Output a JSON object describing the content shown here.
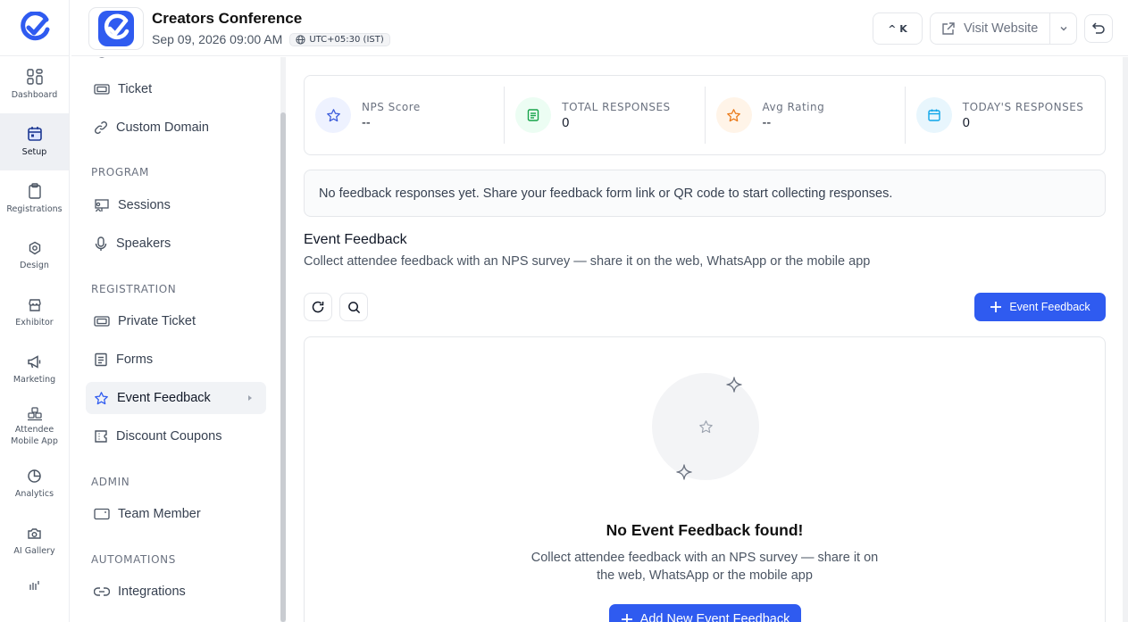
{
  "header": {
    "event_title": "Creators Conference",
    "event_datetime": "Sep 09, 2026 09:00 AM",
    "timezone": "UTC+05:30 (IST)",
    "shortcut_label": "^ K",
    "visit_website_label": "Visit Website"
  },
  "rail": {
    "items": [
      {
        "label": "Dashboard",
        "icon": "grid-icon"
      },
      {
        "label": "Setup",
        "icon": "calendar-icon",
        "active": true
      },
      {
        "label": "Registrations",
        "icon": "clipboard-icon"
      },
      {
        "label": "Design",
        "icon": "palette-icon"
      },
      {
        "label": "Exhibitor",
        "icon": "store-icon"
      },
      {
        "label": "Marketing",
        "icon": "megaphone-icon"
      },
      {
        "label_line1": "Attendee",
        "label_line2": "Mobile App",
        "icon": "boxes-icon"
      },
      {
        "label": "Analytics",
        "icon": "pie-chart-icon"
      },
      {
        "label": "AI Gallery",
        "icon": "camera-icon"
      }
    ]
  },
  "sidebar": {
    "items_top": [
      {
        "label": "Ticket",
        "icon": "ticket-icon"
      },
      {
        "label": "Custom Domain",
        "icon": "link-icon"
      }
    ],
    "sections": {
      "program": "PROGRAM",
      "registration": "REGISTRATION",
      "admin": "ADMIN",
      "automations": "AUTOMATIONS"
    },
    "program_items": [
      {
        "label": "Sessions",
        "icon": "presentation-icon"
      },
      {
        "label": "Speakers",
        "icon": "microphone-icon"
      }
    ],
    "registration_items": [
      {
        "label": "Private Ticket",
        "icon": "ticket-icon"
      },
      {
        "label": "Forms",
        "icon": "form-icon"
      },
      {
        "label": "Event Feedback",
        "icon": "star-icon",
        "active": true
      },
      {
        "label": "Discount Coupons",
        "icon": "coupon-icon"
      }
    ],
    "admin_items": [
      {
        "label": "Team Member",
        "icon": "id-card-icon"
      }
    ],
    "automation_items": [
      {
        "label": "Integrations",
        "icon": "link-icon"
      }
    ]
  },
  "stats": [
    {
      "label": "NPS Score",
      "value": "--",
      "icon": "star-icon",
      "color": "#3b5bdb",
      "bg": "#eef2ff"
    },
    {
      "label": "TOTAL RESPONSES",
      "value": "0",
      "icon": "list-icon",
      "color": "#16a34a",
      "bg": "#ecfdf3"
    },
    {
      "label": "Avg Rating",
      "value": "--",
      "icon": "star-icon",
      "color": "#ea7a1a",
      "bg": "#fff4e8"
    },
    {
      "label": "TODAY'S RESPONSES",
      "value": "0",
      "icon": "calendar-icon",
      "color": "#0ea5e9",
      "bg": "#e8f6fd"
    }
  ],
  "notice": "No feedback responses yet. Share your feedback form link or QR code to start collecting responses.",
  "section": {
    "title": "Event Feedback",
    "description": "Collect attendee feedback with an NPS survey — share it on the web, WhatsApp or the mobile app",
    "add_button": "Event Feedback"
  },
  "empty": {
    "title": "No Event Feedback found!",
    "description": "Collect attendee feedback with an NPS survey — share it on the web, WhatsApp or the mobile app",
    "button": "Add New Event Feedback"
  },
  "colors": {
    "brand": "#2f5bf0",
    "border": "#e5e7eb"
  }
}
